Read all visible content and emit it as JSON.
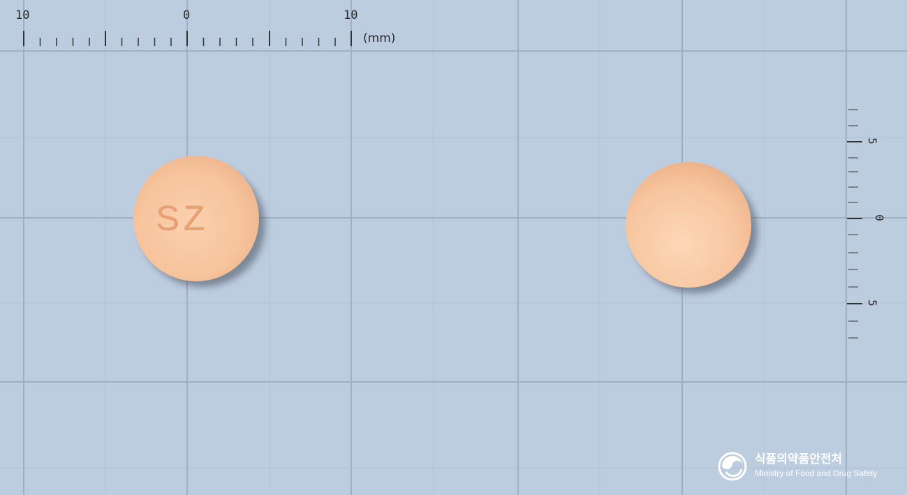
{
  "ruler": {
    "top_labels": [
      "10",
      "0",
      "10"
    ],
    "unit": "(mm)",
    "right_labels": [
      "5",
      "0",
      "5"
    ]
  },
  "tablets": [
    {
      "side": "front",
      "imprint": "SZ",
      "color": "#f6c39c"
    },
    {
      "side": "back",
      "imprint": "",
      "color": "#f8c8a2"
    }
  ],
  "logo": {
    "korean": "식품의약품안전처",
    "english": "Ministry of Food and Drug Safety"
  },
  "colors": {
    "background": "#bdcde0",
    "grid_major": "#9fb0c4",
    "tablet": "#f6c39c",
    "imprint": "#e79a6a"
  }
}
